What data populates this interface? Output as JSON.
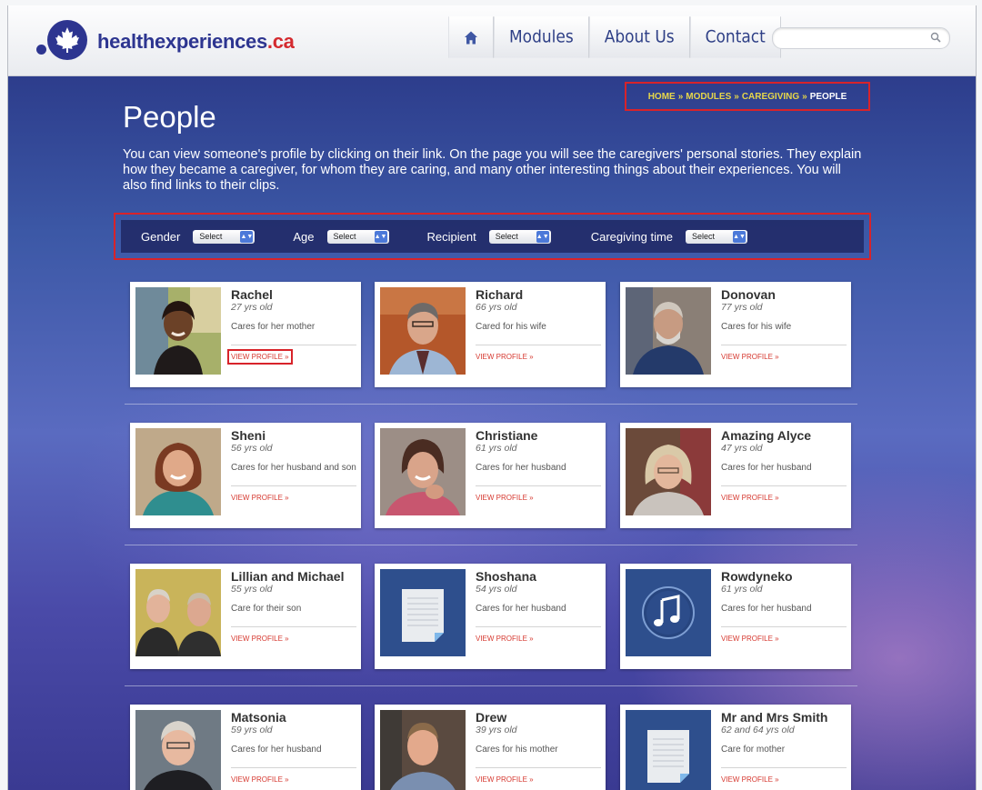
{
  "site": {
    "name_main": "healthexperiences",
    "name_suffix": ".ca"
  },
  "nav": {
    "items": [
      "Modules",
      "About Us",
      "Contact"
    ]
  },
  "search": {
    "placeholder": ""
  },
  "breadcrumb": {
    "home": "HOME",
    "modules": "MODULES",
    "caregiving": "CAREGIVING",
    "current": "PEOPLE",
    "separator": "»"
  },
  "page": {
    "title": "People",
    "intro": "You can view someone's profile by clicking on their link. On the page you will see the caregivers' personal stories. They explain how they became a caregiver, for whom they are caring, and many other interesting things about their experiences. You will also find links to their clips."
  },
  "filters": [
    {
      "label": "Gender",
      "value": "Select"
    },
    {
      "label": "Age",
      "value": "Select"
    },
    {
      "label": "Recipient",
      "value": "Select"
    },
    {
      "label": "Caregiving time",
      "value": "Select"
    }
  ],
  "view_profile_label": "VIEW PROFILE »",
  "people": [
    {
      "name": "Rachel",
      "age": "27 yrs old",
      "cares_for": "Cares for her mother"
    },
    {
      "name": "Richard",
      "age": "66 yrs old",
      "cares_for": "Cared for his wife"
    },
    {
      "name": "Donovan",
      "age": "77 yrs old",
      "cares_for": "Cares for his wife"
    },
    {
      "name": "Sheni",
      "age": "56 yrs old",
      "cares_for": "Cares for her husband and son"
    },
    {
      "name": "Christiane",
      "age": "61 yrs old",
      "cares_for": "Cares for her husband"
    },
    {
      "name": "Amazing Alyce",
      "age": "47 yrs old",
      "cares_for": "Cares for her husband"
    },
    {
      "name": "Lillian and Michael",
      "age": "55 yrs old",
      "cares_for": "Care for their son"
    },
    {
      "name": "Shoshana",
      "age": "54 yrs old",
      "cares_for": "Cares for her husband"
    },
    {
      "name": "Rowdyneko",
      "age": "61 yrs old",
      "cares_for": "Cares for her husband"
    },
    {
      "name": "Matsonia",
      "age": "59 yrs old",
      "cares_for": "Cares for her husband"
    },
    {
      "name": "Drew",
      "age": "39 yrs old",
      "cares_for": "Cares for his mother"
    },
    {
      "name": "Mr and Mrs Smith",
      "age": "62 and 64 yrs old",
      "cares_for": "Care for mother"
    }
  ],
  "icons": {
    "home": "home-icon",
    "search": "search-icon",
    "logo": "maple-leaf-icon",
    "document": "document-icon",
    "music": "music-note-icon"
  },
  "colors": {
    "brand": "#2d3590",
    "accent_red": "#d42a2f",
    "breadcrumb_link": "#e6d64a",
    "highlight_outline": "#d8232a"
  }
}
